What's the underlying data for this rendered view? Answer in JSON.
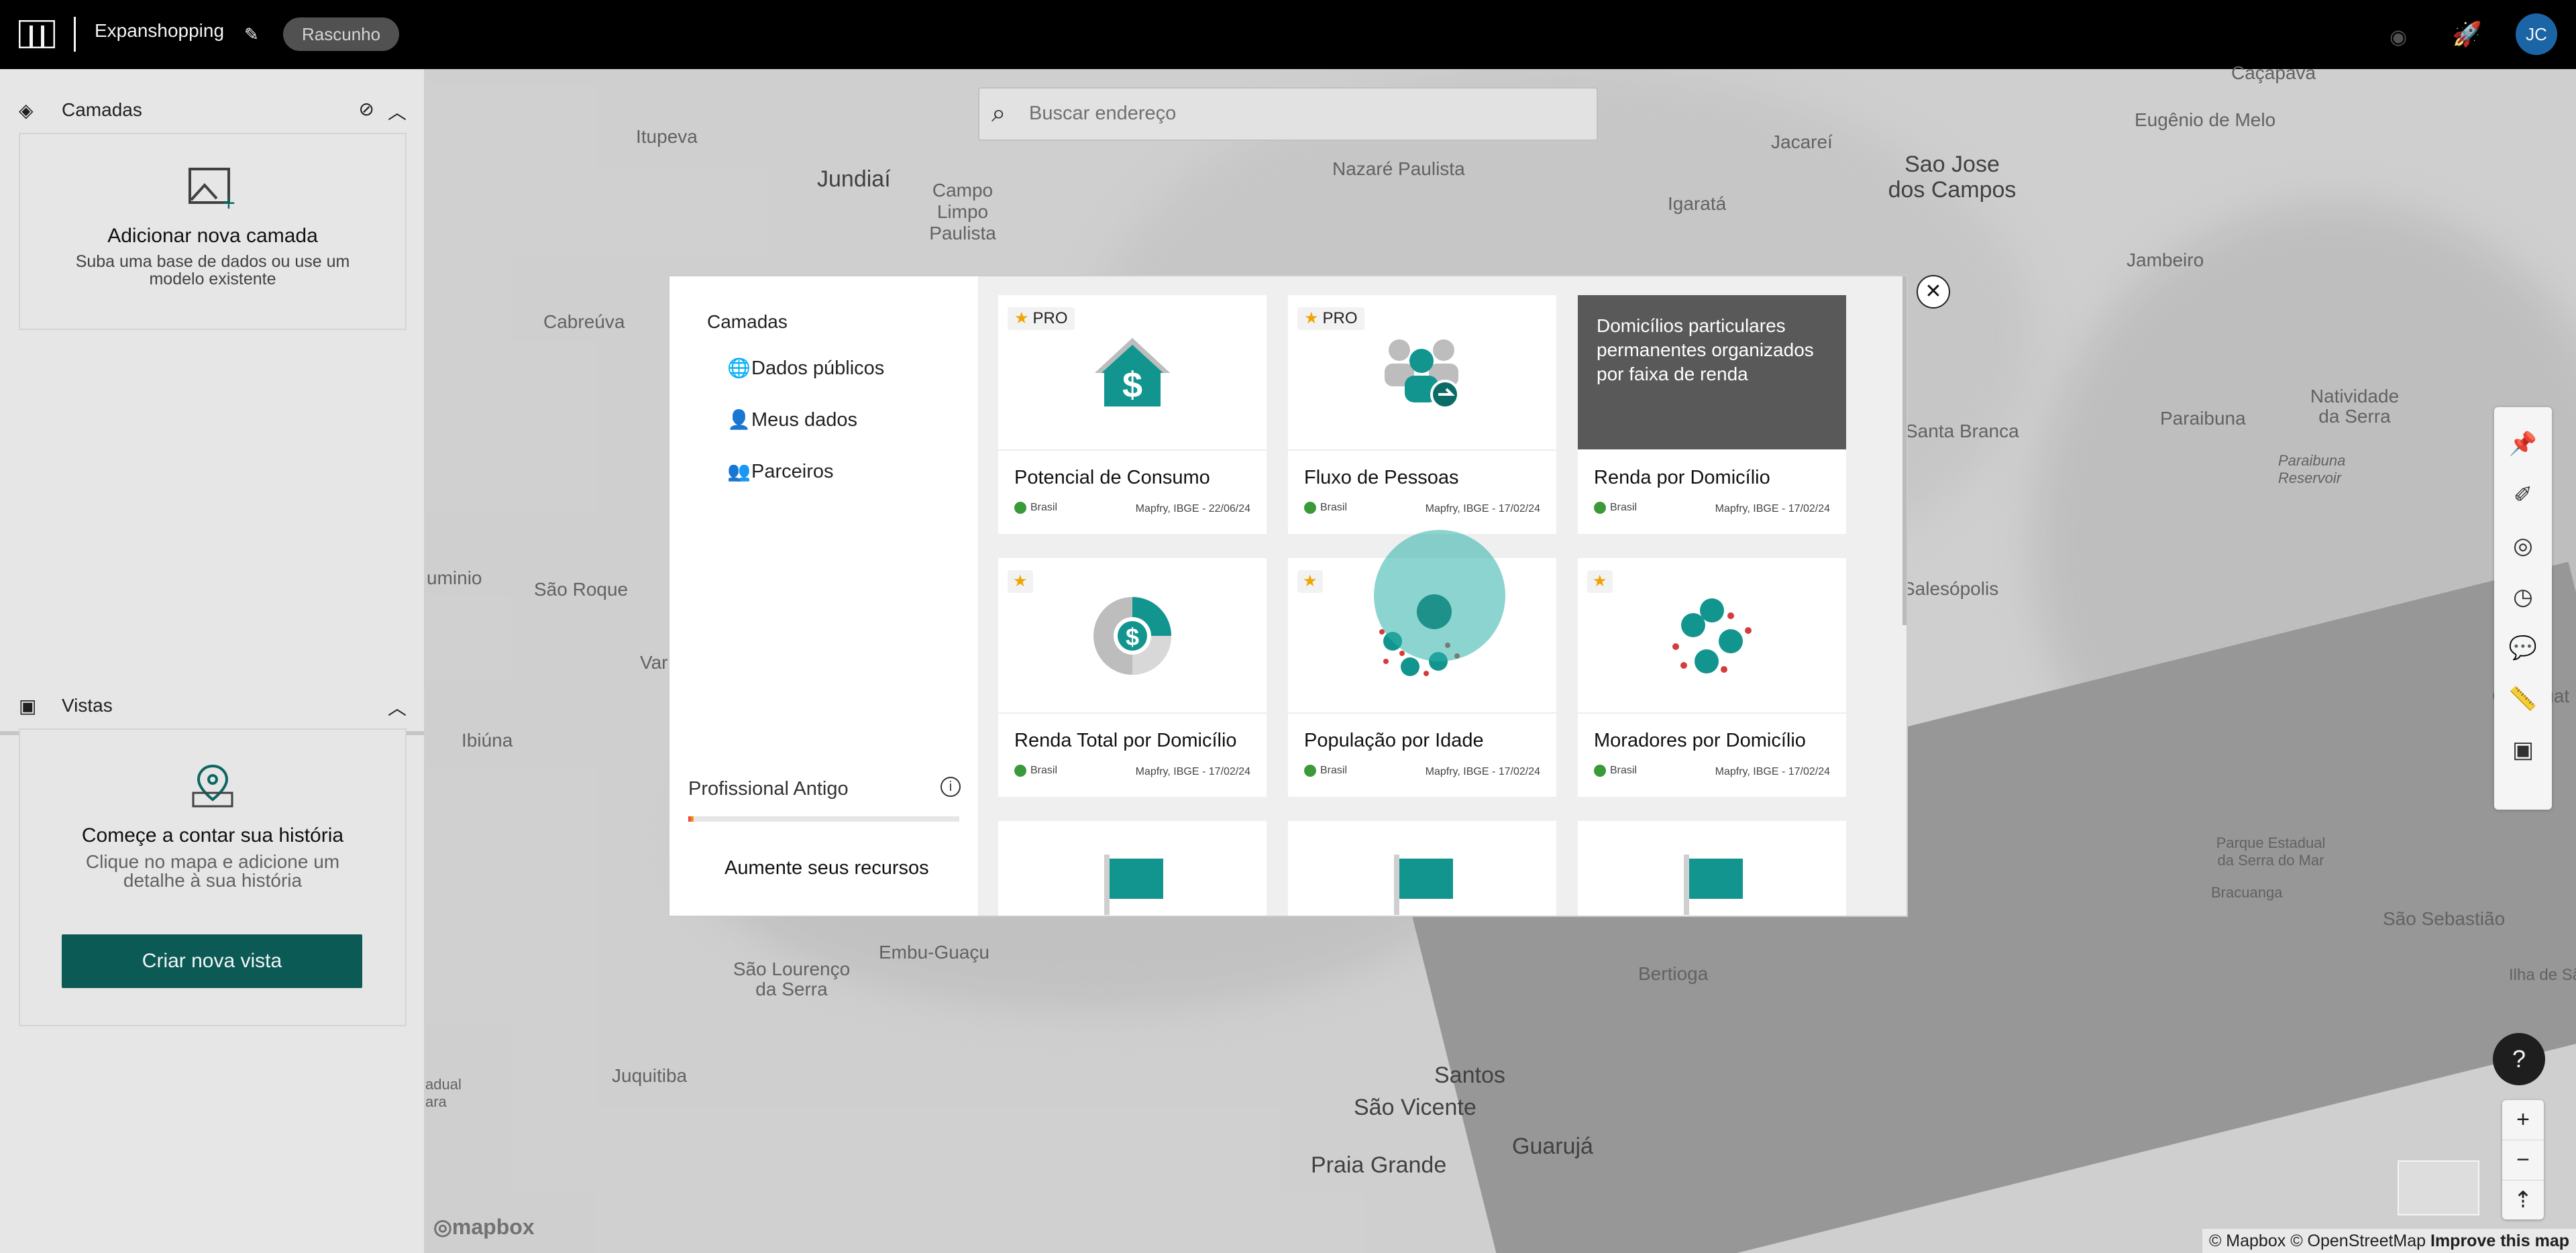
{
  "topbar": {
    "project_name": "Expanshopping",
    "status_badge": "Rascunho",
    "avatar_initials": "JC"
  },
  "search": {
    "placeholder": "Buscar endereço"
  },
  "sidebar": {
    "layers": {
      "title": "Camadas",
      "empty_title": "Adicionar nova camada",
      "empty_sub": "Suba uma base de dados ou use um modelo existente"
    },
    "views": {
      "title": "Vistas",
      "empty_title": "Começe a contar sua história",
      "empty_sub": "Clique no mapa e adicione um detalhe à sua história",
      "button": "Criar nova vista"
    }
  },
  "modal": {
    "category_title": "Camadas",
    "categories": [
      {
        "label": "Dados públicos",
        "icon": "globe-icon"
      },
      {
        "label": "Meus dados",
        "icon": "user-circle-icon"
      },
      {
        "label": "Parceiros",
        "icon": "partners-icon"
      }
    ],
    "plan": {
      "name": "Profissional Antigo",
      "usage_fraction": 0.02,
      "upgrade": "Aumente seus recursos"
    },
    "tiles": [
      {
        "name": "Potencial de Consumo",
        "badge": "PRO",
        "location": "Brasil",
        "source": "Mapfry, IBGE - 22/06/24"
      },
      {
        "name": "Fluxo de Pessoas",
        "badge": "PRO",
        "location": "Brasil",
        "source": "Mapfry, IBGE - 17/02/24"
      },
      {
        "name": "Renda por Domicílio",
        "description": "Domicílios particulares permanentes organizados por faixa de renda",
        "location": "Brasil",
        "source": "Mapfry, IBGE - 17/02/24"
      },
      {
        "name": "Renda Total por Domicílio",
        "location": "Brasil",
        "source": "Mapfry, IBGE - 17/02/24"
      },
      {
        "name": "População por Idade",
        "location": "Brasil",
        "source": "Mapfry, IBGE - 17/02/24"
      },
      {
        "name": "Moradores por Domicílio",
        "location": "Brasil",
        "source": "Mapfry, IBGE - 17/02/24"
      }
    ]
  },
  "map": {
    "labels": [
      "Itupeva",
      "Jundiaí",
      "Campo Limpo Paulista",
      "Nazaré Paulista",
      "Igaratá",
      "Jacareí",
      "Sao Jose dos Campos",
      "Eugênio de Melo",
      "Caçapava",
      "Jambeiro",
      "Cabreúva",
      "Natividade da Serra",
      "Santa Branca",
      "Paraibuna",
      "Paraibuna Reservoir",
      "Salesópolis",
      "São Roque",
      "uminio",
      "Var",
      "Ibiúna",
      "Caraguat",
      "Parque Estadual da Serra do Mar",
      "Bracuanga",
      "São Sebastião",
      "Ilha de São",
      "Embu-Guaçu",
      "São Lourenço da Serra",
      "Juquitiba",
      "Bertioga",
      "Santos",
      "São Vicente",
      "Guarujá",
      "Praia Grande",
      "adual ara"
    ],
    "attribution": "© Mapbox © OpenStreetMap",
    "improve": "Improve this map",
    "mapbox": "mapbox",
    "help": "?"
  }
}
